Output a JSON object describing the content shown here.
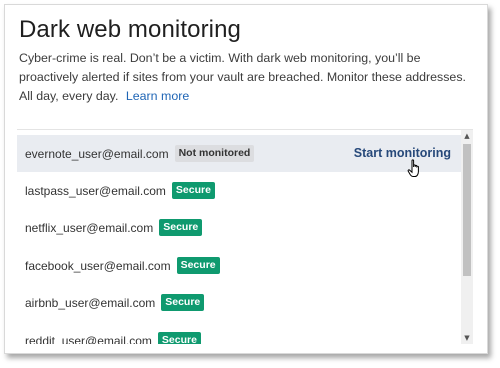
{
  "header": {
    "title": "Dark web monitoring",
    "description": "Cyber-crime is real. Don’t be a victim. With dark web monitoring, you’ll be proactively alerted if sites from your vault are breached. Monitor these addresses. All day, every day.",
    "learn_more": "Learn more"
  },
  "list": {
    "items": [
      {
        "email": "evernote_user@email.com",
        "status": "Not monitored",
        "action": "Start monitoring"
      },
      {
        "email": "lastpass_user@email.com",
        "status": "Secure"
      },
      {
        "email": "netflix_user@email.com",
        "status": "Secure"
      },
      {
        "email": "facebook_user@email.com",
        "status": "Secure"
      },
      {
        "email": "airbnb_user@email.com",
        "status": "Secure"
      },
      {
        "email": "reddit_user@email.com",
        "status": "Secure"
      }
    ]
  },
  "colors": {
    "secure_badge": "#0f9a6f",
    "not_monitored_badge": "#dcdde0",
    "link": "#1f65b5",
    "action": "#27497a",
    "hover_row": "#e9ecf1"
  },
  "icons": {
    "cursor": "hand-pointer-icon",
    "scroll_up": "triangle-up-icon",
    "scroll_down": "triangle-down-icon"
  }
}
